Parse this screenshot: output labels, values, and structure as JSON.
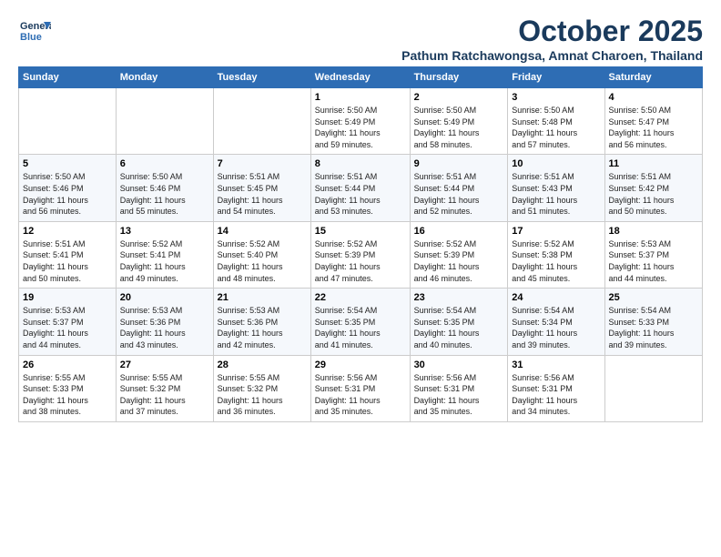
{
  "logo": {
    "line1": "General",
    "line2": "Blue"
  },
  "title": "October 2025",
  "subtitle": "Pathum Ratchawongsa, Amnat Charoen, Thailand",
  "weekdays": [
    "Sunday",
    "Monday",
    "Tuesday",
    "Wednesday",
    "Thursday",
    "Friday",
    "Saturday"
  ],
  "weeks": [
    [
      {
        "day": "",
        "info": ""
      },
      {
        "day": "",
        "info": ""
      },
      {
        "day": "",
        "info": ""
      },
      {
        "day": "1",
        "info": "Sunrise: 5:50 AM\nSunset: 5:49 PM\nDaylight: 11 hours\nand 59 minutes."
      },
      {
        "day": "2",
        "info": "Sunrise: 5:50 AM\nSunset: 5:49 PM\nDaylight: 11 hours\nand 58 minutes."
      },
      {
        "day": "3",
        "info": "Sunrise: 5:50 AM\nSunset: 5:48 PM\nDaylight: 11 hours\nand 57 minutes."
      },
      {
        "day": "4",
        "info": "Sunrise: 5:50 AM\nSunset: 5:47 PM\nDaylight: 11 hours\nand 56 minutes."
      }
    ],
    [
      {
        "day": "5",
        "info": "Sunrise: 5:50 AM\nSunset: 5:46 PM\nDaylight: 11 hours\nand 56 minutes."
      },
      {
        "day": "6",
        "info": "Sunrise: 5:50 AM\nSunset: 5:46 PM\nDaylight: 11 hours\nand 55 minutes."
      },
      {
        "day": "7",
        "info": "Sunrise: 5:51 AM\nSunset: 5:45 PM\nDaylight: 11 hours\nand 54 minutes."
      },
      {
        "day": "8",
        "info": "Sunrise: 5:51 AM\nSunset: 5:44 PM\nDaylight: 11 hours\nand 53 minutes."
      },
      {
        "day": "9",
        "info": "Sunrise: 5:51 AM\nSunset: 5:44 PM\nDaylight: 11 hours\nand 52 minutes."
      },
      {
        "day": "10",
        "info": "Sunrise: 5:51 AM\nSunset: 5:43 PM\nDaylight: 11 hours\nand 51 minutes."
      },
      {
        "day": "11",
        "info": "Sunrise: 5:51 AM\nSunset: 5:42 PM\nDaylight: 11 hours\nand 50 minutes."
      }
    ],
    [
      {
        "day": "12",
        "info": "Sunrise: 5:51 AM\nSunset: 5:41 PM\nDaylight: 11 hours\nand 50 minutes."
      },
      {
        "day": "13",
        "info": "Sunrise: 5:52 AM\nSunset: 5:41 PM\nDaylight: 11 hours\nand 49 minutes."
      },
      {
        "day": "14",
        "info": "Sunrise: 5:52 AM\nSunset: 5:40 PM\nDaylight: 11 hours\nand 48 minutes."
      },
      {
        "day": "15",
        "info": "Sunrise: 5:52 AM\nSunset: 5:39 PM\nDaylight: 11 hours\nand 47 minutes."
      },
      {
        "day": "16",
        "info": "Sunrise: 5:52 AM\nSunset: 5:39 PM\nDaylight: 11 hours\nand 46 minutes."
      },
      {
        "day": "17",
        "info": "Sunrise: 5:52 AM\nSunset: 5:38 PM\nDaylight: 11 hours\nand 45 minutes."
      },
      {
        "day": "18",
        "info": "Sunrise: 5:53 AM\nSunset: 5:37 PM\nDaylight: 11 hours\nand 44 minutes."
      }
    ],
    [
      {
        "day": "19",
        "info": "Sunrise: 5:53 AM\nSunset: 5:37 PM\nDaylight: 11 hours\nand 44 minutes."
      },
      {
        "day": "20",
        "info": "Sunrise: 5:53 AM\nSunset: 5:36 PM\nDaylight: 11 hours\nand 43 minutes."
      },
      {
        "day": "21",
        "info": "Sunrise: 5:53 AM\nSunset: 5:36 PM\nDaylight: 11 hours\nand 42 minutes."
      },
      {
        "day": "22",
        "info": "Sunrise: 5:54 AM\nSunset: 5:35 PM\nDaylight: 11 hours\nand 41 minutes."
      },
      {
        "day": "23",
        "info": "Sunrise: 5:54 AM\nSunset: 5:35 PM\nDaylight: 11 hours\nand 40 minutes."
      },
      {
        "day": "24",
        "info": "Sunrise: 5:54 AM\nSunset: 5:34 PM\nDaylight: 11 hours\nand 39 minutes."
      },
      {
        "day": "25",
        "info": "Sunrise: 5:54 AM\nSunset: 5:33 PM\nDaylight: 11 hours\nand 39 minutes."
      }
    ],
    [
      {
        "day": "26",
        "info": "Sunrise: 5:55 AM\nSunset: 5:33 PM\nDaylight: 11 hours\nand 38 minutes."
      },
      {
        "day": "27",
        "info": "Sunrise: 5:55 AM\nSunset: 5:32 PM\nDaylight: 11 hours\nand 37 minutes."
      },
      {
        "day": "28",
        "info": "Sunrise: 5:55 AM\nSunset: 5:32 PM\nDaylight: 11 hours\nand 36 minutes."
      },
      {
        "day": "29",
        "info": "Sunrise: 5:56 AM\nSunset: 5:31 PM\nDaylight: 11 hours\nand 35 minutes."
      },
      {
        "day": "30",
        "info": "Sunrise: 5:56 AM\nSunset: 5:31 PM\nDaylight: 11 hours\nand 35 minutes."
      },
      {
        "day": "31",
        "info": "Sunrise: 5:56 AM\nSunset: 5:31 PM\nDaylight: 11 hours\nand 34 minutes."
      },
      {
        "day": "",
        "info": ""
      }
    ]
  ]
}
